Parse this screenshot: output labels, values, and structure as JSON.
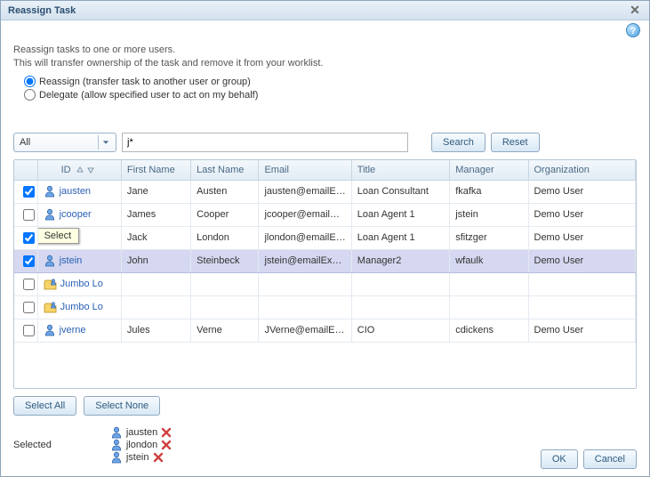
{
  "dialog": {
    "title": "Reassign Task",
    "desc_line1": "Reassign tasks to one or more users.",
    "desc_line2": "This will transfer ownership of the task and remove it from your worklist."
  },
  "options": {
    "reassign_label": "Reassign (transfer task to another user or group)",
    "delegate_label": "Delegate (allow specified user to act on my behalf)"
  },
  "filter": {
    "scope": "All",
    "query": "j*",
    "search_label": "Search",
    "reset_label": "Reset"
  },
  "columns": {
    "id": "ID",
    "first": "First Name",
    "last": "Last Name",
    "email": "Email",
    "title": "Title",
    "manager": "Manager",
    "org": "Organization"
  },
  "rows": [
    {
      "checked": true,
      "type": "user",
      "id": "jausten",
      "first": "Jane",
      "last": "Austen",
      "email": "jausten@emailE…",
      "title": "Loan Consultant",
      "manager": "fkafka",
      "org": "Demo User",
      "tooltip": null,
      "selected": false
    },
    {
      "checked": false,
      "type": "user",
      "id": "jcooper",
      "first": "James",
      "last": "Cooper",
      "email": "jcooper@emailE…",
      "title": "Loan Agent 1",
      "manager": "jstein",
      "org": "Demo User",
      "tooltip": null,
      "selected": false
    },
    {
      "checked": true,
      "type": "user",
      "id": "",
      "first": "Jack",
      "last": "London",
      "email": "jlondon@emailE…",
      "title": "Loan Agent 1",
      "manager": "sfitzger",
      "org": "Demo User",
      "tooltip": "Select",
      "selected": false
    },
    {
      "checked": true,
      "type": "user",
      "id": "jstein",
      "first": "John",
      "last": "Steinbeck",
      "email": "jstein@emailExa…",
      "title": "Manager2",
      "manager": "wfaulk",
      "org": "Demo User",
      "tooltip": null,
      "selected": true
    },
    {
      "checked": false,
      "type": "group",
      "id": "Jumbo Lo",
      "first": "",
      "last": "",
      "email": "",
      "title": "",
      "manager": "",
      "org": "",
      "tooltip": null,
      "selected": false
    },
    {
      "checked": false,
      "type": "group",
      "id": "Jumbo Lo",
      "first": "",
      "last": "",
      "email": "",
      "title": "",
      "manager": "",
      "org": "",
      "tooltip": null,
      "selected": false
    },
    {
      "checked": false,
      "type": "user",
      "id": "jverne",
      "first": "Jules",
      "last": "Verne",
      "email": "JVerne@emailEx…",
      "title": "CIO",
      "manager": "cdickens",
      "org": "Demo User",
      "tooltip": null,
      "selected": false
    }
  ],
  "actions": {
    "select_all": "Select All",
    "select_none": "Select None"
  },
  "selected": {
    "label": "Selected",
    "chips": [
      {
        "id": "jausten"
      },
      {
        "id": "jlondon"
      },
      {
        "id": "jstein"
      }
    ]
  },
  "footer": {
    "ok": "OK",
    "cancel": "Cancel"
  }
}
